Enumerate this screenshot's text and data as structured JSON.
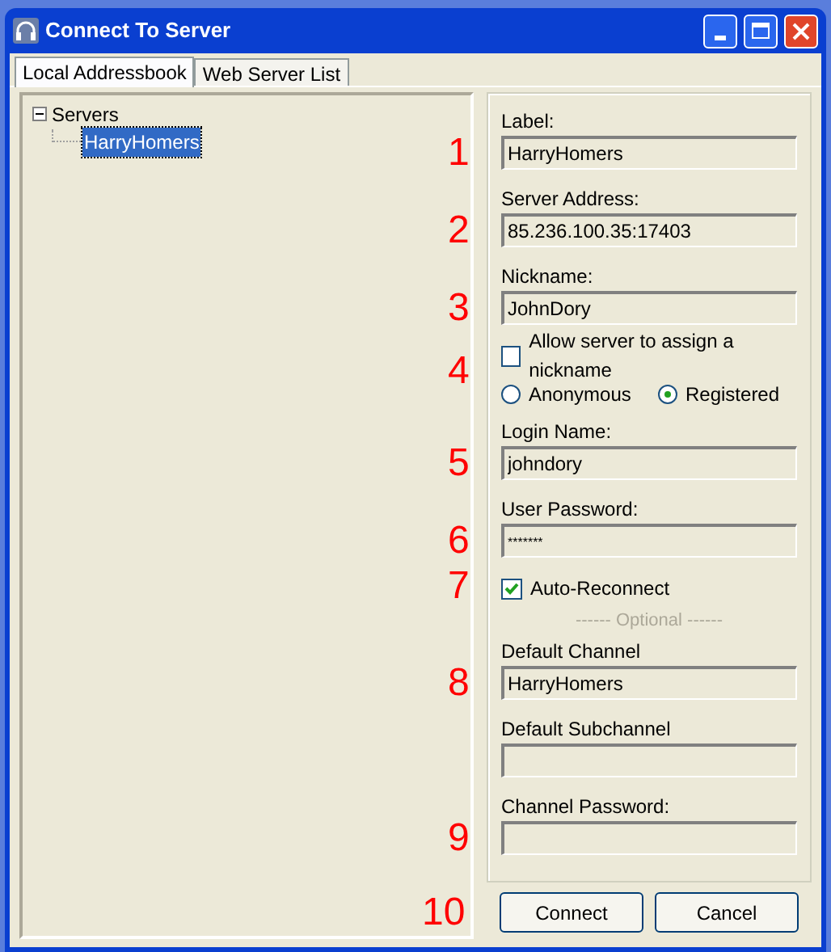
{
  "window": {
    "title": "Connect To Server"
  },
  "tabs": [
    {
      "label": "Local Addressbook",
      "selected": true
    },
    {
      "label": "Web Server List",
      "selected": false
    }
  ],
  "tree": [
    {
      "label": "Servers",
      "expanded": true,
      "selected": false,
      "children": [
        {
          "label": "HarryHomers",
          "selected": true
        }
      ]
    }
  ],
  "form": [
    {
      "kind": "field",
      "label": "Label:",
      "value": "HarryHomers",
      "marker": "1"
    },
    {
      "kind": "field",
      "label": "Server Address:",
      "value": "85.236.100.35:17403",
      "marker": "2"
    },
    {
      "kind": "field",
      "label": "Nickname:",
      "value": "JohnDory",
      "marker": "3"
    },
    {
      "kind": "checkbox",
      "label": "Allow server to assign a nickname",
      "checked": false
    },
    {
      "kind": "radios",
      "marker": "4",
      "options": [
        {
          "label": "Anonymous",
          "selected": false
        },
        {
          "label": "Registered",
          "selected": true
        }
      ]
    },
    {
      "kind": "field",
      "label": "Login Name:",
      "value": "johndory",
      "marker": "5"
    },
    {
      "kind": "field",
      "label": "User Password:",
      "value": "*******",
      "marker": "6"
    },
    {
      "kind": "checkbox",
      "label": "Auto-Reconnect",
      "checked": true,
      "marker": "7"
    },
    {
      "kind": "separator",
      "label": "------ Optional ------"
    },
    {
      "kind": "field",
      "label": "Default Channel",
      "value": "HarryHomers",
      "marker": "8"
    },
    {
      "kind": "field",
      "label": "Default Subchannel"
    },
    {
      "kind": "field",
      "label": "Channel Password:",
      "marker": "9"
    }
  ],
  "buttons": [
    {
      "label": "Connect",
      "marker": "10"
    },
    {
      "label": "Cancel"
    }
  ]
}
